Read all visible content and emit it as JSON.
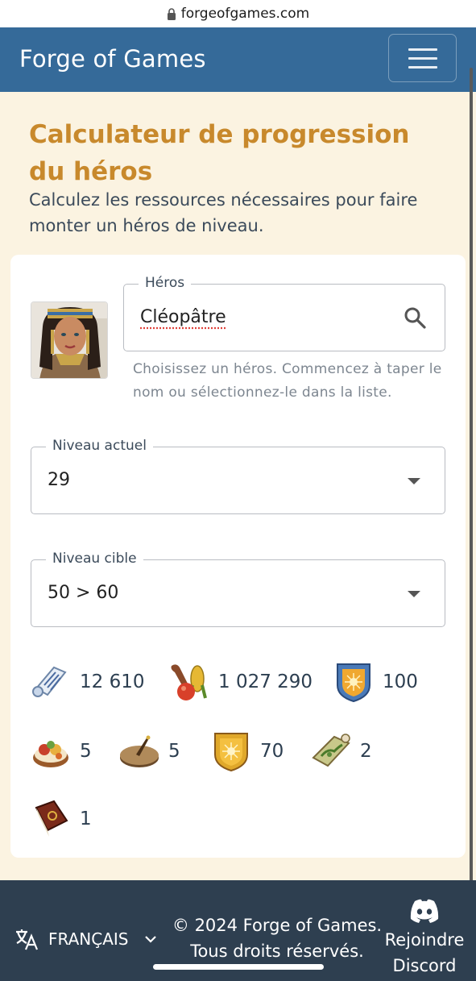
{
  "browser": {
    "url": "forgeofgames.com"
  },
  "navbar": {
    "brand": "Forge of Games"
  },
  "header": {
    "title": "Calculateur de progression du héros",
    "subtitle": "Calculez les ressources nécessaires pour faire monter un héros de niveau."
  },
  "hero": {
    "label": "Héros",
    "value": "Cléopâtre",
    "helper": "Choisissez un héros. Commencez à taper le nom ou sélectionnez-le dans la liste."
  },
  "current_level": {
    "label": "Niveau actuel",
    "value": "29"
  },
  "target_level": {
    "label": "Niveau cible",
    "value": "50 > 60"
  },
  "resources": [
    {
      "icon": "scroll-icon",
      "value": "12 610"
    },
    {
      "icon": "food-icon",
      "value": "1 027 290"
    },
    {
      "icon": "blue-shield-icon",
      "value": "100"
    },
    {
      "icon": "feast-icon",
      "value": "5"
    },
    {
      "icon": "sundial-icon",
      "value": "5"
    },
    {
      "icon": "gold-shield-icon",
      "value": "70"
    },
    {
      "icon": "map-icon",
      "value": "2"
    },
    {
      "icon": "book-icon",
      "value": "1"
    }
  ],
  "footer": {
    "language": "FRANÇAIS",
    "copyright_line1": "© 2024 Forge of Games.",
    "copyright_line2": "Tous droits réservés.",
    "discord_line1": "Rejoindre",
    "discord_line2": "Discord"
  },
  "colors": {
    "navbar": "#356a99",
    "title": "#c8892c",
    "page_bg": "#fbf3e1",
    "footer": "#2e3f50"
  }
}
